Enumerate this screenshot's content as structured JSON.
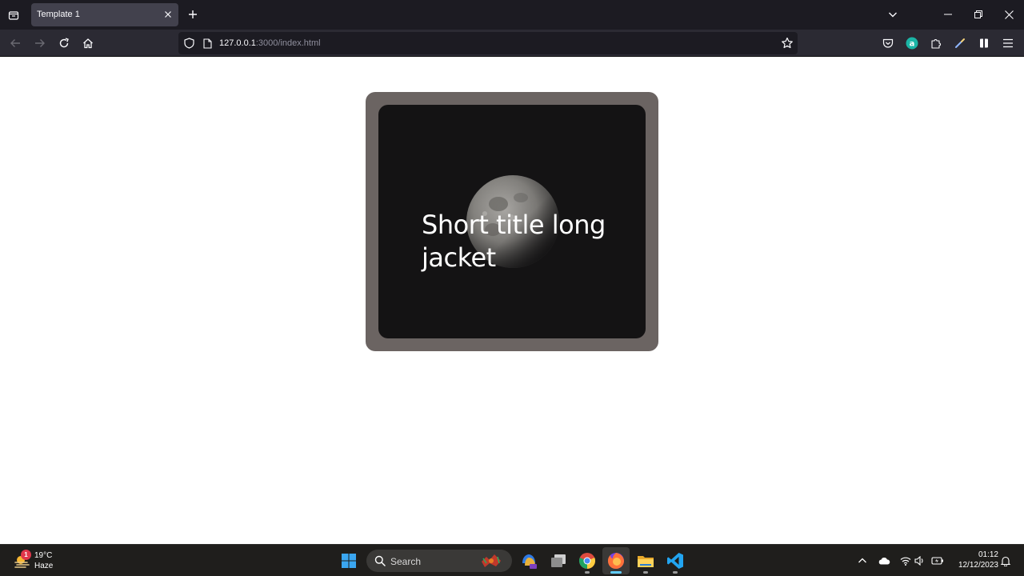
{
  "browser": {
    "tab": {
      "title": "Template 1"
    },
    "url": {
      "host": "127.0.0.1",
      "path": ":3000/index.html"
    }
  },
  "card": {
    "title": "Short title long jacket"
  },
  "taskbar": {
    "weather": {
      "temperature": "19°C",
      "condition": "Haze",
      "badge": "1"
    },
    "search": {
      "label": "Search"
    },
    "clock": {
      "time": "01:12",
      "date": "12/12/2023"
    }
  },
  "colors": {
    "card_frame": "#6b6462",
    "card_inner": "#141314",
    "browser_chrome": "#1c1b22",
    "toolbar": "#2b2a33",
    "taskbar": "#1f1e1c"
  }
}
